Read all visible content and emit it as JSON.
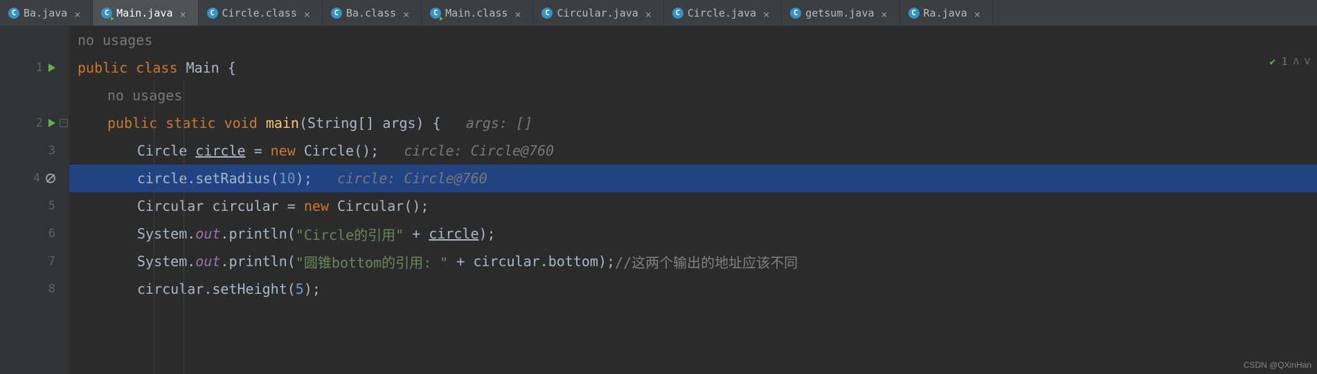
{
  "tabs": [
    {
      "label": "Ba.java",
      "icon": "c"
    },
    {
      "label": "Main.java",
      "icon": "run",
      "active": true
    },
    {
      "label": "Circle.class",
      "icon": "c"
    },
    {
      "label": "Ba.class",
      "icon": "c"
    },
    {
      "label": "Main.class",
      "icon": "run"
    },
    {
      "label": "Circular.java",
      "icon": "c"
    },
    {
      "label": "Circle.java",
      "icon": "c"
    },
    {
      "label": "getsum.java",
      "icon": "c"
    },
    {
      "label": "Ra.java",
      "icon": "c"
    }
  ],
  "usages_top": "no usages",
  "usages_inner": "no usages",
  "inspection": {
    "count": "1"
  },
  "gutter": {
    "lines": [
      "1",
      "2",
      "3",
      "4",
      "5",
      "6",
      "7",
      "8"
    ]
  },
  "code": {
    "l1": {
      "kw1": "public",
      "kw2": "class",
      "name": "Main",
      "brace": " {"
    },
    "l2": {
      "kw1": "public",
      "kw2": "static",
      "kw3": "void",
      "name": "main",
      "params": "(String[] args) {",
      "hint": "args: []"
    },
    "l3": {
      "type": "Circle",
      "var": "circle",
      "eq": " = ",
      "kw": "new",
      "ctor": " Circle();",
      "hint": "circle: Circle@760"
    },
    "l4": {
      "obj": "circle",
      "call": ".setRadius(",
      "num": "10",
      "tail": ");",
      "hint": "circle: Circle@760"
    },
    "l5": {
      "type": "Circular ",
      "var": "circular",
      "eq": " = ",
      "kw": "new",
      "ctor": " Circular();"
    },
    "l6": {
      "pre": "System.",
      "out": "out",
      "mid": ".println(",
      "str": "\"Circle的引用\"",
      "plus": " + ",
      "var": "circle",
      "tail": ");"
    },
    "l7": {
      "pre": "System.",
      "out": "out",
      "mid": ".println(",
      "str": "\"圆锥bottom的引用: \"",
      "plus": " + circular.bottom);",
      "comment": "//这两个输出的地址应该不同"
    },
    "l8": {
      "obj": "circular.setHeight(",
      "num": "5",
      "tail": ");"
    }
  },
  "watermark": "CSDN @QXinHan"
}
